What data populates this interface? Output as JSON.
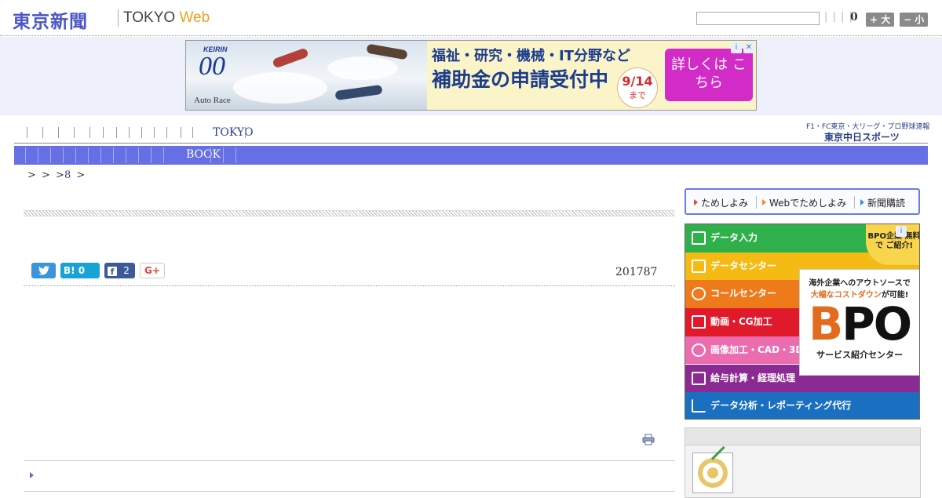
{
  "header": {
    "logo_ja": "東京新聞",
    "logo_en_tokyo": "TOKYO",
    "logo_en_web": "Web",
    "search_placeholder": "",
    "separator_bars": "| | | |",
    "count": "0",
    "font_larger_label": "+ 大",
    "font_smaller_label": "− 小"
  },
  "top_ad": {
    "keirin": "KEIRIN",
    "logo_mark": "00",
    "auto_race": "Auto Race",
    "line1": "福祉・研究・機械・IT分野など",
    "line2": "補助金の申請受付中",
    "date": "9/14",
    "date_suffix": "まで",
    "cta": "詳しくは こちら",
    "adchoices_icon": "info-icon",
    "close_icon": "close-icon"
  },
  "nav": {
    "primary_label": "TOKYO",
    "chunichi_sub": "F1・FC東京・大リーグ・プロ野球速報",
    "chunichi_main": "東京中日スポーツ",
    "secondary_label": "BOOK"
  },
  "breadcrumb": {
    "text_before": "> > >",
    "number": "8",
    "text_after": ">"
  },
  "share": {
    "twitter_icon": "twitter-icon",
    "hatena_label": "B! 0",
    "facebook_count": "2",
    "gplus_label": "G+"
  },
  "article": {
    "date": "201787"
  },
  "sidebar": {
    "tame_1": "ためしよみ",
    "tame_2": "Webでためしよみ",
    "tame_3": "新聞購読",
    "bpo_bands": [
      {
        "label": "データ入力",
        "color": "#2fb04a",
        "icon": "c-icon"
      },
      {
        "label": "データセンター",
        "color": "#f5bb14",
        "icon": "server-icon"
      },
      {
        "label": "コールセンター",
        "color": "#ef7a1c",
        "icon": "phone-icon"
      },
      {
        "label": "動画・CG加工",
        "color": "#e0192b",
        "icon": "film-icon"
      },
      {
        "label": "画像加工・CAD・3D",
        "color": "#ec6cb0",
        "icon": "scissors-icon"
      },
      {
        "label": "給与計算・経理処理",
        "color": "#8c2a93",
        "icon": "document-icon"
      },
      {
        "label": "データ分析・レポーティング代行",
        "color": "#1a6fc0",
        "icon": "chart-icon"
      }
    ],
    "bpo_badge": "BPO企業 無料で ご紹介!",
    "bpo_text1": "海外企業へのアウトソースで",
    "bpo_text2_orange": "大幅なコストダウン",
    "bpo_text2_rest": "が可能!",
    "bpo_big_b": "B",
    "bpo_big_po": "PO",
    "bpo_text3": "サービス紹介センター"
  }
}
